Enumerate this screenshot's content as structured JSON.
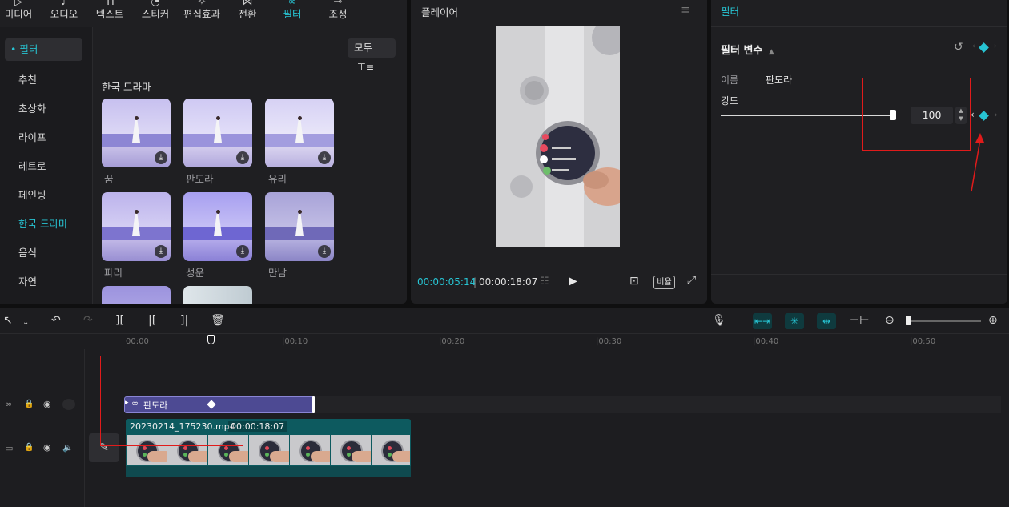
{
  "tabs": [
    {
      "icon": "media-icon",
      "label": "미디어"
    },
    {
      "icon": "audio-icon",
      "label": "오디오"
    },
    {
      "icon": "text-icon",
      "label": "텍스트"
    },
    {
      "icon": "sticker-icon",
      "label": "스티커"
    },
    {
      "icon": "effects-icon",
      "label": "편집효과"
    },
    {
      "icon": "transition-icon",
      "label": "전환"
    },
    {
      "icon": "filter-icon",
      "label": "필터",
      "active": true
    },
    {
      "icon": "adjust-icon",
      "label": "조정"
    }
  ],
  "sidebar": {
    "items": [
      {
        "label": "• 필터",
        "state": "selected-header"
      },
      {
        "label": "추천"
      },
      {
        "label": "초상화"
      },
      {
        "label": "라이프"
      },
      {
        "label": "레트로"
      },
      {
        "label": "페인팅"
      },
      {
        "label": "한국 드라마",
        "state": "active"
      },
      {
        "label": "음식"
      },
      {
        "label": "자연"
      }
    ]
  },
  "library": {
    "filter_button": "모두",
    "section_title": "한국 드라마",
    "items": [
      {
        "label": "꿈",
        "tint": "#9b93d8"
      },
      {
        "label": "판도라",
        "tint": "#a79fe0"
      },
      {
        "label": "유리",
        "tint": "#b0a8e4"
      },
      {
        "label": "파리",
        "tint": "#8f87d6"
      },
      {
        "label": "성운",
        "tint": "#7f78d8"
      },
      {
        "label": "만남",
        "tint": "#8a86c8"
      }
    ]
  },
  "player": {
    "title": "플레이어",
    "current_time": "00:00:05:14",
    "total_time": "00:00:18:07",
    "ratio_label": "비율"
  },
  "properties": {
    "tab_title": "필터",
    "section_title": "필터 변수",
    "name_label": "이름",
    "name_value": "판도라",
    "strength_label": "강도",
    "strength_value": "100",
    "strength_fraction": 1.0
  },
  "timeline": {
    "ruler_labels": [
      "00:00",
      "|00:10",
      "|00:20",
      "|00:30",
      "|00:40",
      "|00:50"
    ],
    "filter_clip_label": "판도라",
    "video_clip_name": "20230214_175230.mp4",
    "video_clip_duration": "00:00:18:07"
  },
  "colors": {
    "accent": "#27c4d3",
    "filter_clip": "#4d4a93",
    "video_clip": "#0d5a5f",
    "annotation": "#e01b1b"
  }
}
